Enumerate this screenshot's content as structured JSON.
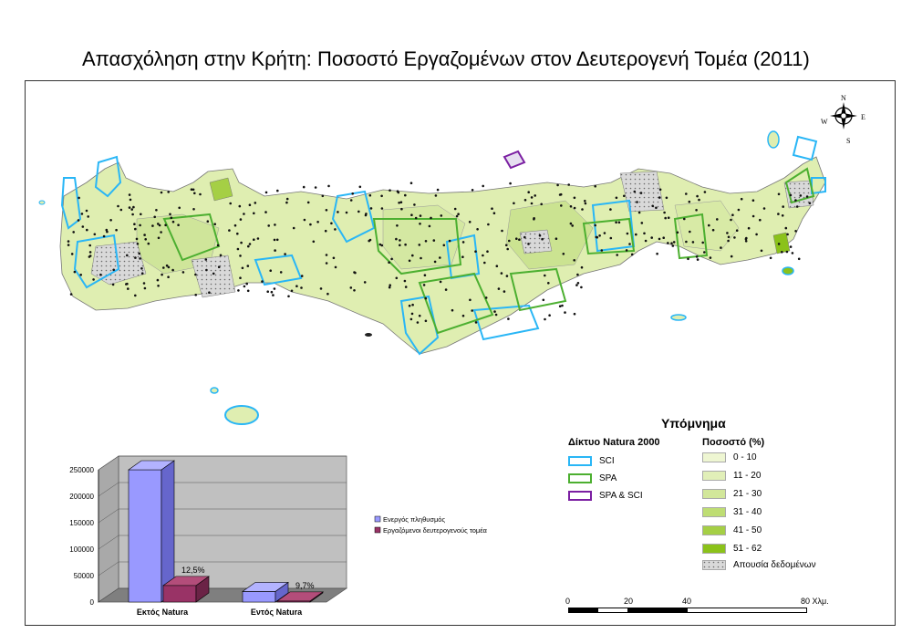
{
  "title": "Απασχόληση στην Κρήτη: Ποσοστό Εργαζομένων στον Δευτερογενή Τομέα (2011)",
  "compass": {
    "n": "N",
    "s": "S",
    "e": "E",
    "w": "W"
  },
  "legend": {
    "title": "Υπόμνημα",
    "natura_header": "Δίκτυο Natura 2000",
    "natura_items": [
      {
        "label": "SCI",
        "color": "#29b6f6"
      },
      {
        "label": "SPA",
        "color": "#4caf30"
      },
      {
        "label": "SPA & SCI",
        "color": "#7b1fa2"
      }
    ],
    "pct_header": "Ποσοστό (%)",
    "pct_items": [
      {
        "label": "0 - 10",
        "color": "#eef6d2"
      },
      {
        "label": "11 - 20",
        "color": "#e1efb8"
      },
      {
        "label": "21 - 30",
        "color": "#d2e79a"
      },
      {
        "label": "31 - 40",
        "color": "#bedd73"
      },
      {
        "label": "41 - 50",
        "color": "#a5cf45"
      },
      {
        "label": "51 - 62",
        "color": "#8bc21a"
      }
    ],
    "nodata_label": "Απουσία δεδομένων"
  },
  "scale_bar": {
    "ticks": [
      "0",
      "20",
      "40",
      "80 Χλμ."
    ]
  },
  "chart_data": {
    "type": "bar",
    "categories": [
      "Εκτός Natura",
      "Εντός Natura"
    ],
    "series": [
      {
        "name": "Ενεργός πληθυσμός",
        "values": [
          250000,
          20000
        ],
        "color": "#9999ff"
      },
      {
        "name": "Εργαζόμενοι δευτερογενούς τομέα",
        "values": [
          31250,
          1940
        ],
        "color": "#993366"
      }
    ],
    "data_labels": [
      "12,5%",
      "9,7%"
    ],
    "ylim": [
      0,
      250000
    ],
    "yticks": [
      "0",
      "50000",
      "100000",
      "150000",
      "200000",
      "250000"
    ],
    "legend_position": "right"
  }
}
